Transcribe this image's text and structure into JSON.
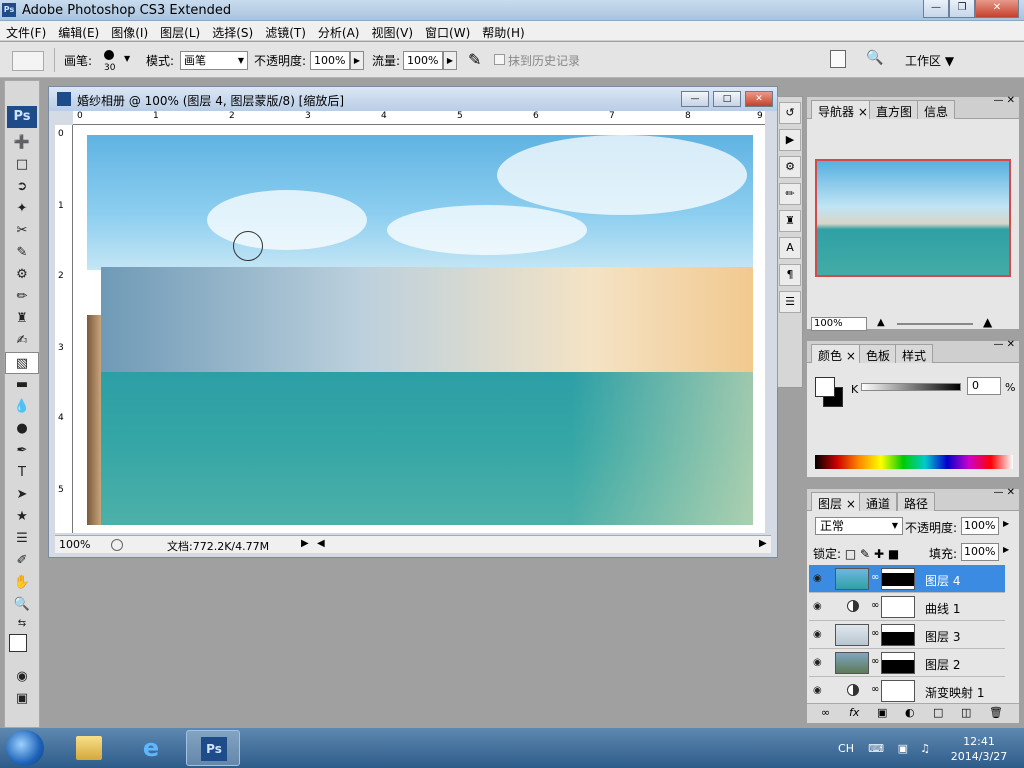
{
  "app": {
    "title": "Adobe Photoshop CS3 Extended",
    "ps_logo": "Ps"
  },
  "menu": [
    "文件(F)",
    "编辑(E)",
    "图像(I)",
    "图层(L)",
    "选择(S)",
    "滤镜(T)",
    "分析(A)",
    "视图(V)",
    "窗口(W)",
    "帮助(H)"
  ],
  "options": {
    "brush_label": "画笔:",
    "brush_size": "30",
    "mode_label": "模式:",
    "mode_value": "画笔",
    "opacity_label": "不透明度:",
    "opacity_value": "100%",
    "flow_label": "流量:",
    "flow_value": "100%",
    "history_label": "抹到历史记录",
    "workspace_label": "工作区"
  },
  "document": {
    "title": "婚纱相册 @ 100% (图层 4, 图层蒙版/8) [缩放后]",
    "ruler_top": [
      "0",
      "1",
      "2",
      "3",
      "4",
      "5",
      "6",
      "7",
      "8",
      "9"
    ],
    "ruler_left": [
      "0",
      "1",
      "2",
      "3",
      "4",
      "5"
    ],
    "zoom": "100%",
    "doc_info": "文档:772.2K/4.77M"
  },
  "navigator": {
    "tabs": [
      "导航器",
      "直方图",
      "信息"
    ],
    "zoom": "100%"
  },
  "color": {
    "tabs": [
      "颜色",
      "色板",
      "样式"
    ],
    "channel": "K",
    "value": "0",
    "unit": "%"
  },
  "layers": {
    "tabs": [
      "图层",
      "通道",
      "路径"
    ],
    "blend_mode": "正常",
    "opacity_label": "不透明度:",
    "opacity_value": "100%",
    "lock_label": "锁定:",
    "fill_label": "填充:",
    "fill_value": "100%",
    "items": [
      {
        "name": "图层 4",
        "selected": true
      },
      {
        "name": "曲线 1",
        "selected": false
      },
      {
        "name": "图层 3",
        "selected": false
      },
      {
        "name": "图层 2",
        "selected": false
      },
      {
        "name": "渐变映射 1",
        "selected": false
      }
    ]
  },
  "taskbar": {
    "lang": "CH",
    "time": "12:41",
    "date": "2014/3/27"
  }
}
